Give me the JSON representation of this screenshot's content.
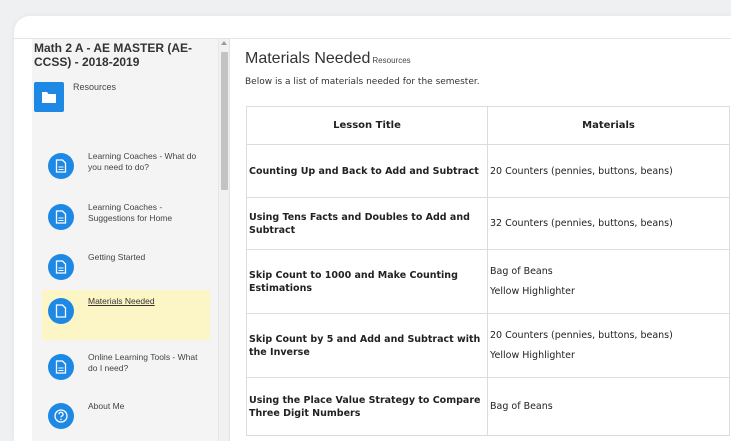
{
  "course": {
    "title": "Math 2 A - AE MASTER (AE-CCSS) - 2018-2019"
  },
  "sidebar": {
    "folder_label": "Resources",
    "items": [
      {
        "label": "Learning Coaches - What do you need to do?",
        "icon": "document-icon",
        "active": false
      },
      {
        "label": "Learning Coaches - Suggestions for Home",
        "icon": "document-icon",
        "active": false
      },
      {
        "label": "Getting Started",
        "icon": "document-icon",
        "active": false
      },
      {
        "label": "Materials Needed",
        "icon": "page-icon",
        "active": true
      },
      {
        "label": "Online Learning Tools - What do I need?",
        "icon": "document-icon",
        "active": false
      },
      {
        "label": "About Me",
        "icon": "question-icon",
        "active": false
      }
    ]
  },
  "main": {
    "title": "Materials Needed",
    "title_sub": "Resources",
    "intro": "Below is a list of materials needed for the semester.",
    "table": {
      "headers": [
        "Lesson Title",
        "Materials"
      ],
      "rows": [
        {
          "lesson": "Counting Up and Back to Add and Subtract",
          "materials": [
            "20 Counters (pennies, buttons, beans)"
          ]
        },
        {
          "lesson": "Using Tens Facts and Doubles to Add and Subtract",
          "materials": [
            "32 Counters (pennies, buttons, beans)"
          ]
        },
        {
          "lesson": "Skip Count to 1000 and Make Counting Estimations",
          "materials": [
            "Bag of Beans",
            "Yellow Highlighter"
          ]
        },
        {
          "lesson": "Skip Count by 5 and Add and Subtract with the Inverse",
          "materials": [
            "20 Counters (pennies, buttons, beans)",
            "Yellow Highlighter"
          ]
        },
        {
          "lesson": "Using the Place Value Strategy to Compare Three Digit Numbers",
          "materials": [
            "Bag of Beans"
          ]
        }
      ]
    }
  },
  "colors": {
    "accent": "#1e88e5",
    "active_bg": "#fcf5c6"
  }
}
